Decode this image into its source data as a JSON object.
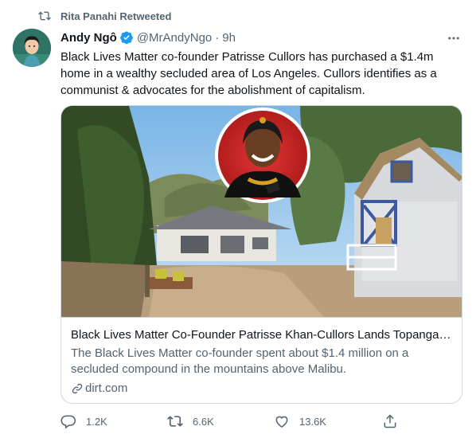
{
  "retweet": {
    "text": "Rita Panahi Retweeted"
  },
  "tweet": {
    "author_name": "Andy Ngô",
    "handle": "@MrAndyNgo",
    "separator": "·",
    "time": "9h",
    "text": "Black Lives Matter co-founder Patrisse Cullors has purchased a $1.4m home in a wealthy secluded area of Los Angeles. Cullors identifies as a communist & advocates for the abolishment of capitalism."
  },
  "card": {
    "title": "Black Lives Matter Co-Founder Patrisse Khan-Cullors Lands Topanga Ca...",
    "description": "The Black Lives Matter co-founder spent about $1.4 million on a secluded compound in the mountains above Malibu.",
    "domain": "dirt.com"
  },
  "actions": {
    "replies": "1.2K",
    "retweets": "6.6K",
    "likes": "13.6K"
  },
  "colors": {
    "accent": "#1d9bf0",
    "secondary_text": "#536471",
    "border": "#cfd9de"
  },
  "icons": [
    "retweet-icon",
    "verified-badge-icon",
    "more-icon",
    "link-icon",
    "reply-icon",
    "like-icon",
    "share-icon"
  ]
}
